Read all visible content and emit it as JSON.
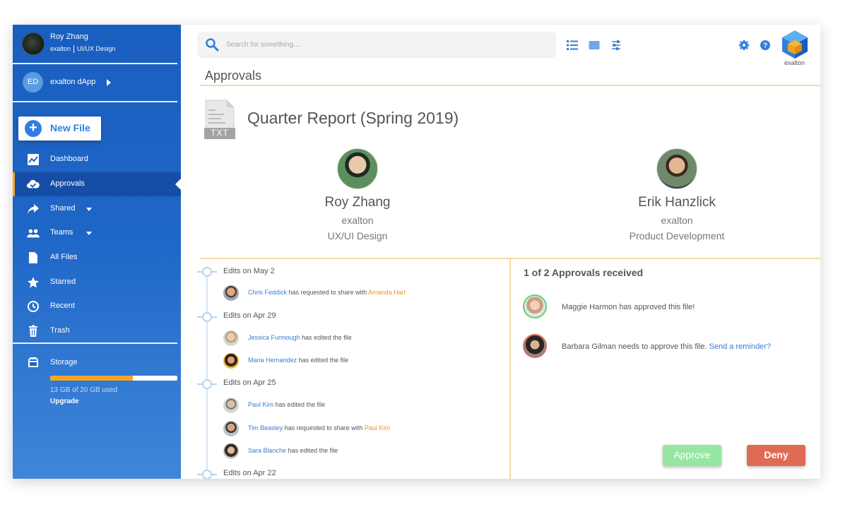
{
  "sidebar": {
    "profile": {
      "name": "Roy Zhang",
      "company": "exalton",
      "role": "UI/UX Design"
    },
    "workspace": {
      "initials": "ED",
      "label": "exalton dApp"
    },
    "new_file_label": "New File",
    "items": [
      {
        "label": "Dashboard",
        "icon": "chart-icon"
      },
      {
        "label": "Approvals",
        "icon": "cloud-check-icon",
        "active": true
      },
      {
        "label": "Shared",
        "icon": "share-arrow-icon",
        "has_caret": true
      },
      {
        "label": "Teams",
        "icon": "people-icon",
        "has_caret": true
      },
      {
        "label": "All Files",
        "icon": "file-icon"
      },
      {
        "label": "Starred",
        "icon": "star-icon"
      },
      {
        "label": "Recent",
        "icon": "clock-icon"
      },
      {
        "label": "Trash",
        "icon": "trash-icon"
      }
    ],
    "storage": {
      "label": "Storage",
      "used_text": "13 GB of 20 GB used",
      "used_fraction": 0.65,
      "upgrade_label": "Upgrade"
    }
  },
  "topbar": {
    "search_placeholder": "Search for something....",
    "brand": "exalton"
  },
  "page": {
    "title": "Approvals",
    "file_type": "TXT",
    "file_title": "Quarter Report (Spring 2019)"
  },
  "people": [
    {
      "name": "Roy Zhang",
      "org": "exalton",
      "dept": "UX/UI Design"
    },
    {
      "name": "Erik Hanzlick",
      "org": "exalton",
      "dept": "Product Development"
    }
  ],
  "timeline": [
    {
      "date": "Edits on May 2",
      "entries": [
        {
          "user": "Chris Feddick",
          "action": "has requested to share with",
          "target": "Amanda Hart"
        }
      ]
    },
    {
      "date": "Edits on Apr 29",
      "entries": [
        {
          "user": "Jessica Furmough",
          "action": "has edited the file",
          "target": ""
        },
        {
          "user": "Maria Hernandez",
          "action": "has edited the file",
          "target": ""
        }
      ]
    },
    {
      "date": "Edits on Apr 25",
      "entries": [
        {
          "user": "Paul Kim",
          "action": "has edited the file",
          "target": ""
        },
        {
          "user": "Tim Beasley",
          "action": "has requested to share with",
          "target": "Paul Kim"
        },
        {
          "user": "Sara Blanche",
          "action": "has edited the file",
          "target": ""
        }
      ]
    },
    {
      "date": "Edits on Apr 22",
      "entries": []
    }
  ],
  "approvals": {
    "summary": "1 of 2 Approvals received",
    "items": [
      {
        "text": "Maggie Harmon has approved this file!",
        "link": "",
        "status": "approved"
      },
      {
        "text": "Barbara Gilman needs to approve this file.",
        "link": "Send a reminder?",
        "status": "pending"
      }
    ],
    "approve_label": "Approve",
    "deny_label": "Deny"
  },
  "colors": {
    "accent": "#f5a623",
    "primary": "#1e66c6",
    "approved": "#5fd36f",
    "pending": "#e06b55"
  }
}
